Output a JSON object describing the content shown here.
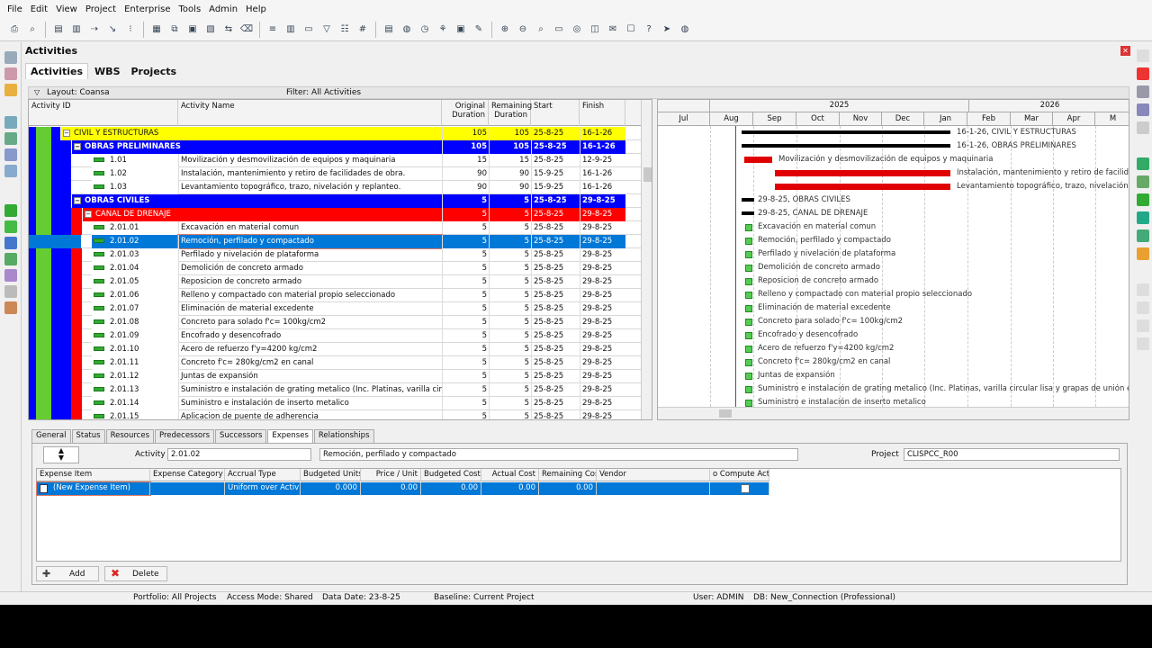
{
  "menu": [
    "File",
    "Edit",
    "View",
    "Project",
    "Enterprise",
    "Tools",
    "Admin",
    "Help"
  ],
  "panel": {
    "title": "Activities"
  },
  "tabs": [
    "Activities",
    "WBS",
    "Projects"
  ],
  "layout_bar": {
    "layout": "Layout: Coansa",
    "filter": "Filter: All Activities"
  },
  "columns": {
    "activity_id": "Activity ID",
    "activity_name": "Activity Name",
    "orig_dur": "Original Duration",
    "rem_dur": "Remaining Duration",
    "start": "Start",
    "finish": "Finish"
  },
  "rows": [
    {
      "id": "CIVIL Y ESTRUCTURAS",
      "name": "",
      "od": "105",
      "rd": "105",
      "start": "25-8-25",
      "finish": "16-1-26",
      "type": "wbs1"
    },
    {
      "id": "OBRAS PRELIMINARES",
      "name": "",
      "od": "105",
      "rd": "105",
      "start": "25-8-25",
      "finish": "16-1-26",
      "type": "wbs2"
    },
    {
      "id": "1.01",
      "name": "Movilización y desmovilización de equipos y maquinaria",
      "od": "15",
      "rd": "15",
      "start": "25-8-25",
      "finish": "12-9-25",
      "type": "act"
    },
    {
      "id": "1.02",
      "name": "Instalación, mantenimiento y retiro de facilidades de obra.",
      "od": "90",
      "rd": "90",
      "start": "15-9-25",
      "finish": "16-1-26",
      "type": "act"
    },
    {
      "id": "1.03",
      "name": "Levantamiento topográfico, trazo, nivelación y replanteo.",
      "od": "90",
      "rd": "90",
      "start": "15-9-25",
      "finish": "16-1-26",
      "type": "act"
    },
    {
      "id": "OBRAS CIVILES",
      "name": "",
      "od": "5",
      "rd": "5",
      "start": "25-8-25",
      "finish": "29-8-25",
      "type": "wbs2"
    },
    {
      "id": "CANAL DE DRENAJE",
      "name": "",
      "od": "5",
      "rd": "5",
      "start": "25-8-25",
      "finish": "29-8-25",
      "type": "wbs3"
    },
    {
      "id": "2.01.01",
      "name": "Excavación en material comun",
      "od": "5",
      "rd": "5",
      "start": "25-8-25",
      "finish": "29-8-25",
      "type": "act"
    },
    {
      "id": "2.01.02",
      "name": "Remoción, perfilado y compactado",
      "od": "5",
      "rd": "5",
      "start": "25-8-25",
      "finish": "29-8-25",
      "type": "sel"
    },
    {
      "id": "2.01.03",
      "name": "Perfilado y nivelación de plataforma",
      "od": "5",
      "rd": "5",
      "start": "25-8-25",
      "finish": "29-8-25",
      "type": "act"
    },
    {
      "id": "2.01.04",
      "name": "Demolición de concreto armado",
      "od": "5",
      "rd": "5",
      "start": "25-8-25",
      "finish": "29-8-25",
      "type": "act"
    },
    {
      "id": "2.01.05",
      "name": "Reposicion de concreto armado",
      "od": "5",
      "rd": "5",
      "start": "25-8-25",
      "finish": "29-8-25",
      "type": "act"
    },
    {
      "id": "2.01.06",
      "name": "Relleno y compactado con material propio seleccionado",
      "od": "5",
      "rd": "5",
      "start": "25-8-25",
      "finish": "29-8-25",
      "type": "act"
    },
    {
      "id": "2.01.07",
      "name": "Eliminación de material excedente",
      "od": "5",
      "rd": "5",
      "start": "25-8-25",
      "finish": "29-8-25",
      "type": "act"
    },
    {
      "id": "2.01.08",
      "name": "Concreto para solado f'c= 100kg/cm2",
      "od": "5",
      "rd": "5",
      "start": "25-8-25",
      "finish": "29-8-25",
      "type": "act"
    },
    {
      "id": "2.01.09",
      "name": "Encofrado y desencofrado",
      "od": "5",
      "rd": "5",
      "start": "25-8-25",
      "finish": "29-8-25",
      "type": "act"
    },
    {
      "id": "2.01.10",
      "name": "Acero de refuerzo f'y=4200 kg/cm2",
      "od": "5",
      "rd": "5",
      "start": "25-8-25",
      "finish": "29-8-25",
      "type": "act"
    },
    {
      "id": "2.01.11",
      "name": "Concreto f'c= 280kg/cm2 en canal",
      "od": "5",
      "rd": "5",
      "start": "25-8-25",
      "finish": "29-8-25",
      "type": "act"
    },
    {
      "id": "2.01.12",
      "name": "Juntas de expansión",
      "od": "5",
      "rd": "5",
      "start": "25-8-25",
      "finish": "29-8-25",
      "type": "act"
    },
    {
      "id": "2.01.13",
      "name": "Suministro e instalación de grating metalico (Inc. Platinas, varilla circular li",
      "od": "5",
      "rd": "5",
      "start": "25-8-25",
      "finish": "29-8-25",
      "type": "act"
    },
    {
      "id": "2.01.14",
      "name": "Suministro e instalación de inserto metalico",
      "od": "5",
      "rd": "5",
      "start": "25-8-25",
      "finish": "29-8-25",
      "type": "act"
    },
    {
      "id": "2.01.15",
      "name": "Aplicacion de puente de adherencia",
      "od": "5",
      "rd": "5",
      "start": "25-8-25",
      "finish": "29-8-25",
      "type": "act"
    }
  ],
  "gantt": {
    "years": [
      "2025",
      "2026"
    ],
    "months": [
      "Jul",
      "Aug",
      "Sep",
      "Oct",
      "Nov",
      "Dec",
      "Jan",
      "Feb",
      "Mar",
      "Apr",
      "M"
    ],
    "labels": [
      "16-1-26, CIVIL Y ESTRUCTURAS",
      "16-1-26, OBRAS PRELIMINARES",
      "Movilización y desmovilización de equipos y maquinaria",
      "Instalación, mantenimiento y retiro de facilidad",
      "Levantamiento topográfico, trazo, nivelación",
      "29-8-25, OBRAS CIVILES",
      "29-8-25, CANAL DE DRENAJE",
      "Excavación en material comun",
      "Remoción, perfilado y compactado",
      "Perfilado y nivelación de plataforma",
      "Demolición de concreto armado",
      "Reposicion de concreto armado",
      "Relleno y compactado con material propio seleccionado",
      "Eliminación de material excedente",
      "Concreto para solado f'c= 100kg/cm2",
      "Encofrado y desencofrado",
      "Acero de refuerzo f'y=4200 kg/cm2",
      "Concreto f'c= 280kg/cm2 en canal",
      "Juntas de expansión",
      "Suministro e instalación de grating metalico (Inc. Platinas, varilla circular lisa y grapas de unión entre e",
      "Suministro e instalación de inserto metalico"
    ]
  },
  "bottom_tabs": [
    "General",
    "Status",
    "Resources",
    "Predecessors",
    "Successors",
    "Expenses",
    "Relationships"
  ],
  "detail": {
    "activity_label": "Activity",
    "activity_id": "2.01.02",
    "activity_name": "Remoción, perfilado y compactado",
    "project_label": "Project",
    "project_id": "CLISPCC_R00"
  },
  "expense_cols": [
    "Expense Item",
    "Expense Category",
    "Accrual Type",
    "Budgeted Units",
    "Price / Unit",
    "Budgeted Cost",
    "Actual Cost",
    "Remaining Cost",
    "Vendor",
    "o Compute Act"
  ],
  "expense_row": [
    "(New Expense Item)",
    "",
    "Uniform over Activit",
    "0.000",
    "0.00",
    "0.00",
    "0.00",
    "0.00",
    "",
    ""
  ],
  "buttons": {
    "add": "Add",
    "delete": "Delete"
  },
  "status": {
    "portfolio": "Portfolio: All Projects",
    "access": "Access Mode: Shared",
    "data_date": "Data Date: 23-8-25",
    "baseline": "Baseline: Current Project",
    "user": "User: ADMIN",
    "db": "DB: New_Connection (Professional)"
  },
  "colors": {
    "wbs1": "#ffff00",
    "wbs2": "#0000ff",
    "wbs3": "#ff0000",
    "selected": "#0078d7",
    "bar_red": "#e00000"
  }
}
